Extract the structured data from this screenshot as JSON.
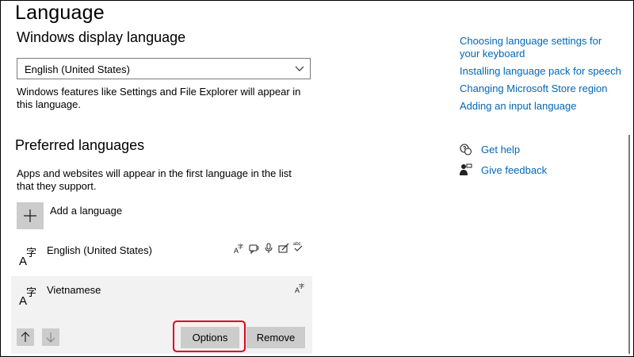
{
  "page": {
    "title": "Language"
  },
  "display_language": {
    "heading": "Windows display language",
    "selected_value": "English (United States)",
    "description": "Windows features like Settings and File Explorer will appear in this language."
  },
  "preferred": {
    "heading": "Preferred languages",
    "description": "Apps and websites will appear in the first language in the list that they support.",
    "add_label": "Add a language",
    "languages": [
      {
        "name": "English (United States)",
        "features": [
          "display-language-icon",
          "text-to-speech-icon",
          "speech-recognition-icon",
          "handwriting-icon",
          "spell-check-icon"
        ]
      },
      {
        "name": "Vietnamese",
        "features": [
          "display-language-icon"
        ]
      }
    ],
    "options_label": "Options",
    "remove_label": "Remove"
  },
  "related": {
    "links": [
      "Choosing language settings for your keyboard",
      "Installing language pack for speech",
      "Changing Microsoft Store region",
      "Adding an input language"
    ],
    "get_help": "Get help",
    "give_feedback": "Give feedback"
  },
  "colors": {
    "link": "#0067b8",
    "highlight": "#e0001b",
    "button_bg": "#cccccc",
    "selected_row_bg": "#f2f2f2"
  }
}
